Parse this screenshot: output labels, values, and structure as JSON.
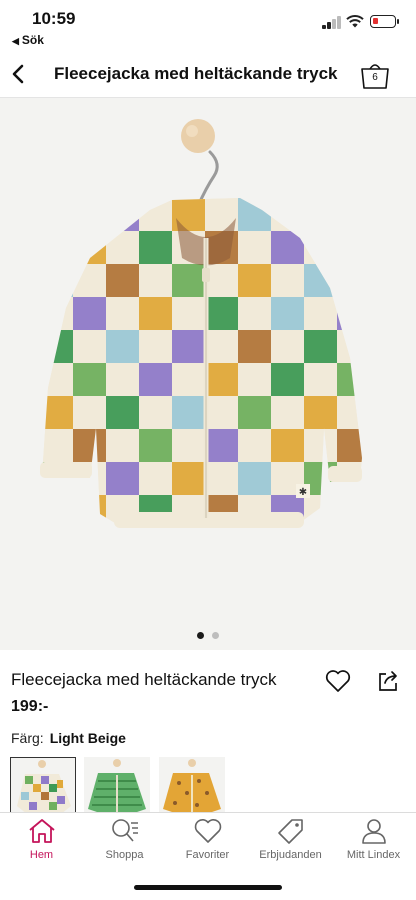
{
  "status": {
    "time": "10:59",
    "back_app": "Sök"
  },
  "header": {
    "title": "Fleecejacka med heltäckande tryck",
    "cart_count": "6"
  },
  "gallery": {
    "image_count": 2,
    "active_index": 0
  },
  "product": {
    "name": "Fleecejacka med heltäckande tryck",
    "price": "199:-"
  },
  "color": {
    "label": "Färg:",
    "value": "Light Beige"
  },
  "variants": [
    {
      "name": "Light Beige",
      "selected": true
    },
    {
      "name": "Green",
      "selected": false
    },
    {
      "name": "Yellow",
      "selected": false
    }
  ],
  "tabs": [
    {
      "label": "Hem",
      "icon": "home-icon",
      "active": true
    },
    {
      "label": "Shoppa",
      "icon": "search-list-icon",
      "active": false
    },
    {
      "label": "Favoriter",
      "icon": "heart-icon",
      "active": false
    },
    {
      "label": "Erbjudanden",
      "icon": "tag-icon",
      "active": false
    },
    {
      "label": "Mitt Lindex",
      "icon": "user-icon",
      "active": false
    }
  ],
  "colors": {
    "accent": "#c4145a",
    "battery_low": "#e23030"
  }
}
